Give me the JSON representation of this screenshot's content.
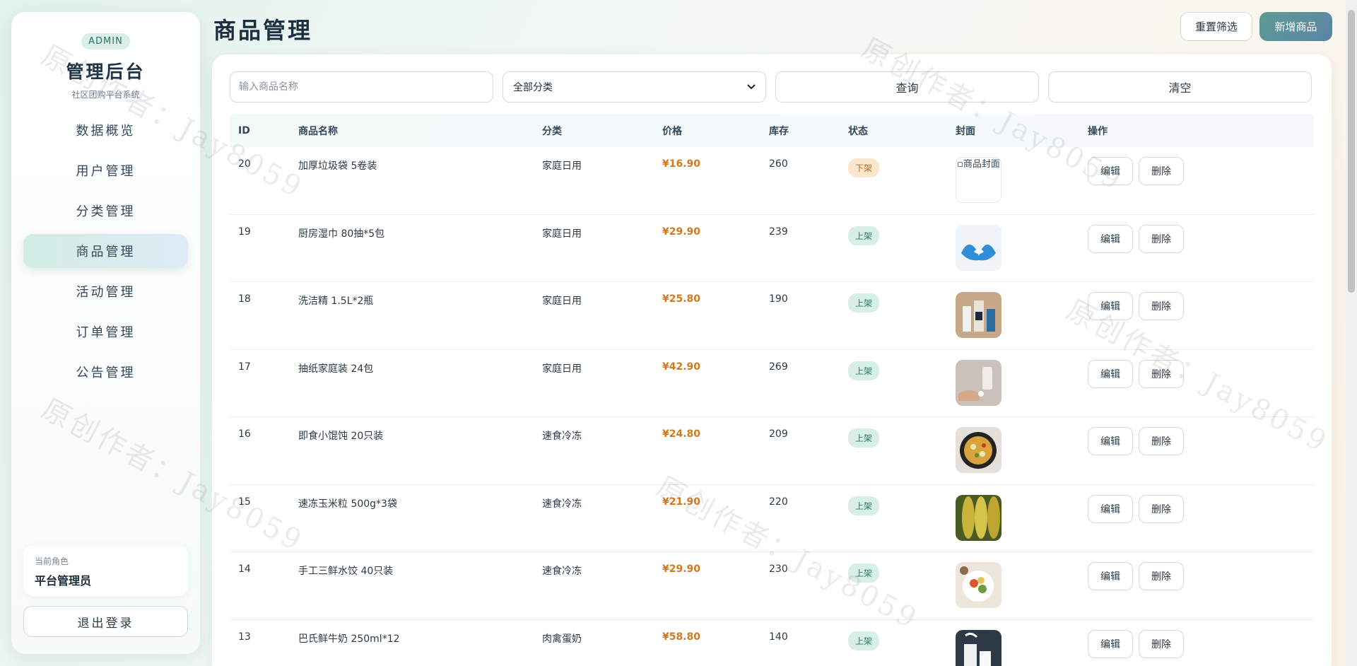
{
  "sidebar": {
    "badge": "ADMIN",
    "title": "管理后台",
    "subtitle": "社区团购平台系统",
    "items": [
      {
        "label": "数据概览",
        "active": false
      },
      {
        "label": "用户管理",
        "active": false
      },
      {
        "label": "分类管理",
        "active": false
      },
      {
        "label": "商品管理",
        "active": true
      },
      {
        "label": "活动管理",
        "active": false
      },
      {
        "label": "订单管理",
        "active": false
      },
      {
        "label": "公告管理",
        "active": false
      }
    ],
    "role_label": "当前角色",
    "role_value": "平台管理员",
    "logout_label": "退出登录"
  },
  "header": {
    "title": "商品管理",
    "reset_label": "重置筛选",
    "add_label": "新增商品"
  },
  "filters": {
    "name_placeholder": "输入商品名称",
    "category_value": "全部分类",
    "query_label": "查询",
    "clear_label": "清空"
  },
  "table": {
    "columns": [
      "ID",
      "商品名称",
      "分类",
      "价格",
      "库存",
      "状态",
      "封面",
      "操作"
    ],
    "edit_label": "编辑",
    "delete_label": "删除",
    "rows": [
      {
        "id": "20",
        "name": "加厚垃圾袋 5卷装",
        "category": "家庭日用",
        "price": "¥16.90",
        "stock": "260",
        "status": "下架",
        "cover_alt": "商品封面",
        "cover": "broken"
      },
      {
        "id": "19",
        "name": "厨房湿巾 80抽*5包",
        "category": "家庭日用",
        "price": "¥29.90",
        "stock": "239",
        "status": "上架",
        "cover": "gloves"
      },
      {
        "id": "18",
        "name": "洗洁精 1.5L*2瓶",
        "category": "家庭日用",
        "price": "¥25.80",
        "stock": "190",
        "status": "上架",
        "cover": "bottles"
      },
      {
        "id": "17",
        "name": "抽纸家庭装 24包",
        "category": "家庭日用",
        "price": "¥42.90",
        "stock": "269",
        "status": "上架",
        "cover": "soap"
      },
      {
        "id": "16",
        "name": "即食小馄饨 20只装",
        "category": "速食冷冻",
        "price": "¥24.80",
        "stock": "209",
        "status": "上架",
        "cover": "pan"
      },
      {
        "id": "15",
        "name": "速冻玉米粒 500g*3袋",
        "category": "速食冷冻",
        "price": "¥21.90",
        "stock": "220",
        "status": "上架",
        "cover": "corn"
      },
      {
        "id": "14",
        "name": "手工三鲜水饺 40只装",
        "category": "速食冷冻",
        "price": "¥29.90",
        "stock": "230",
        "status": "上架",
        "cover": "salad"
      },
      {
        "id": "13",
        "name": "巴氏鲜牛奶 250ml*12",
        "category": "肉禽蛋奶",
        "price": "¥58.80",
        "stock": "140",
        "status": "上架",
        "cover": "milk"
      }
    ]
  },
  "watermark": "原创作者：Jay8059",
  "colors": {
    "accent": "#5e9b93",
    "price": "#d07a1f",
    "status_on_bg": "#d8efe6",
    "status_off_bg": "#fbe7cd"
  }
}
